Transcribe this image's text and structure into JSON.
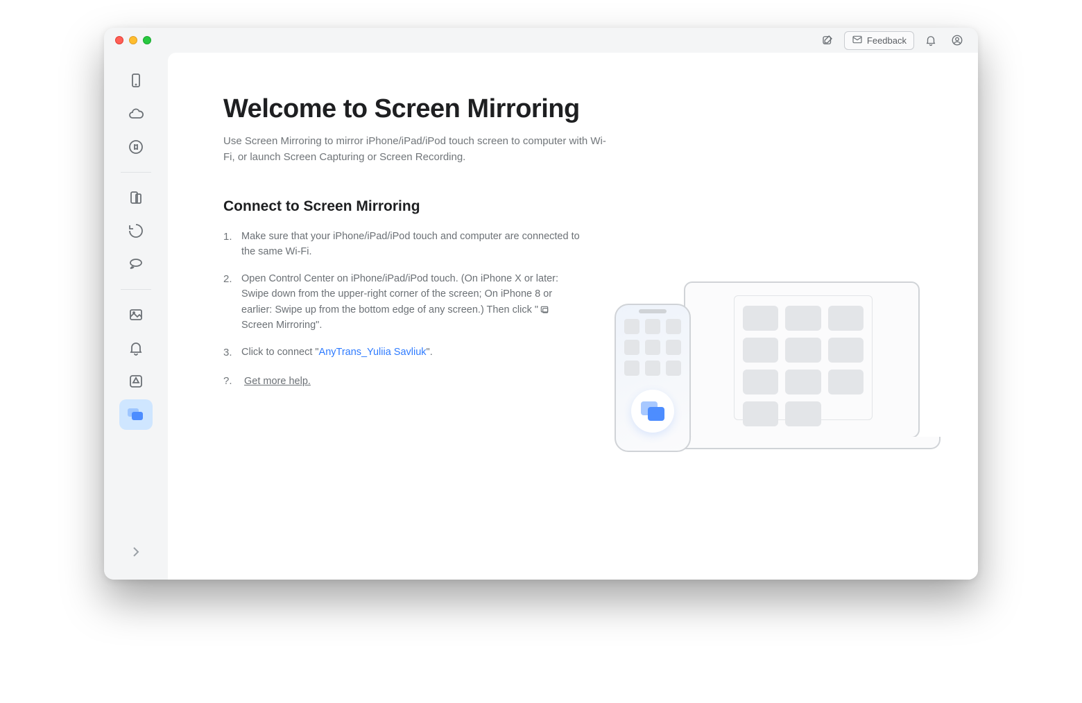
{
  "titlebar": {
    "feedback_label": "Feedback"
  },
  "page": {
    "title": "Welcome to Screen Mirroring",
    "subtitle": "Use Screen Mirroring to mirror iPhone/iPad/iPod touch screen to computer with Wi-Fi, or launch Screen Capturing or Screen Recording."
  },
  "section": {
    "title": "Connect to Screen Mirroring"
  },
  "steps": {
    "s1": "Make sure that your iPhone/iPad/iPod touch and computer are connected to the same Wi-Fi.",
    "s2_a": "Open Control Center on iPhone/iPad/iPod touch. (On iPhone X or later: Swipe down from the upper-right corner of the screen; On iPhone 8 or earlier: Swipe up from the bottom edge of any screen.) Then click \"",
    "s2_mirror_label": " Screen Mirroring",
    "s2_b": "\".",
    "s3_a": "Click to connect \"",
    "s3_device": "AnyTrans_Yuliia Savliuk",
    "s3_b": "\"."
  },
  "help": {
    "q": "?.",
    "label": "Get more help."
  }
}
